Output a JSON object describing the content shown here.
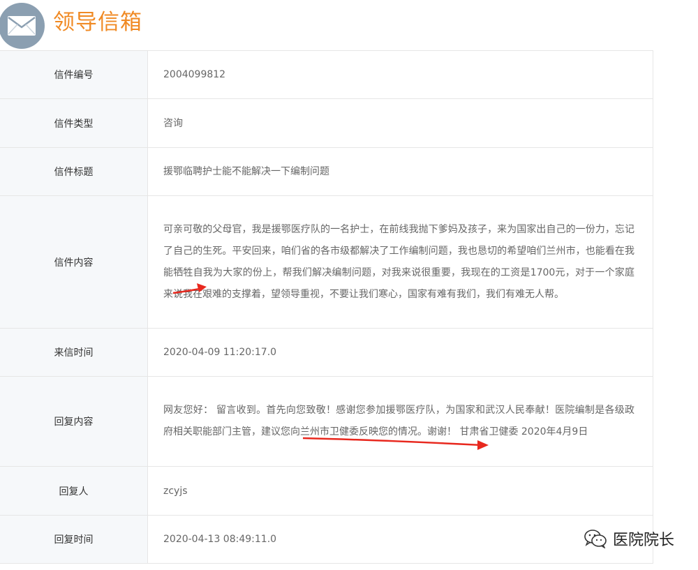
{
  "header": {
    "title": "领导信箱",
    "icon": "mail-icon"
  },
  "rows": [
    {
      "label": "信件编号",
      "value": "2004099812"
    },
    {
      "label": "信件类型",
      "value": "咨询"
    },
    {
      "label": "信件标题",
      "value": "援鄂临聘护士能不能解决一下编制问题"
    },
    {
      "label": "信件内容",
      "value": "可亲可敬的父母官，我是援鄂医疗队的一名护士，在前线我抛下爹妈及孩子，来为国家出自己的一份力，忘记了自己的生死。平安回来，咱们省的各市级都解决了工作编制问题，我也恳切的希望咱们兰州市，也能看在我能牺牲自我为大家的份上，帮我们解决编制问题，对我来说很重要，我现在的工资是1700元，对于一个家庭来说我在艰难的支撑着，望领导重视，不要让我们寒心，国家有难有我们，我们有难无人帮。"
    },
    {
      "label": "来信时间",
      "value": "2020-04-09 11:20:17.0"
    },
    {
      "label": "回复内容",
      "value": "网友您好： 留言收到。首先向您致敬！感谢您参加援鄂医疗队，为国家和武汉人民奉献！医院编制是各级政府相关职能部门主管，建议您向兰州市卫健委反映您的情况。谢谢！ 甘肃省卫健委 2020年4月9日"
    },
    {
      "label": "回复人",
      "value": "zcyjs"
    },
    {
      "label": "回复时间",
      "value": "2020-04-13 08:49:11.0"
    }
  ],
  "watermark": {
    "text": "医院院长",
    "icon": "wechat-icon"
  },
  "colors": {
    "title": "#f08a24",
    "label_bg": "#f6f8fa",
    "border": "#e6e6e6",
    "arrow": "#e8281e"
  }
}
